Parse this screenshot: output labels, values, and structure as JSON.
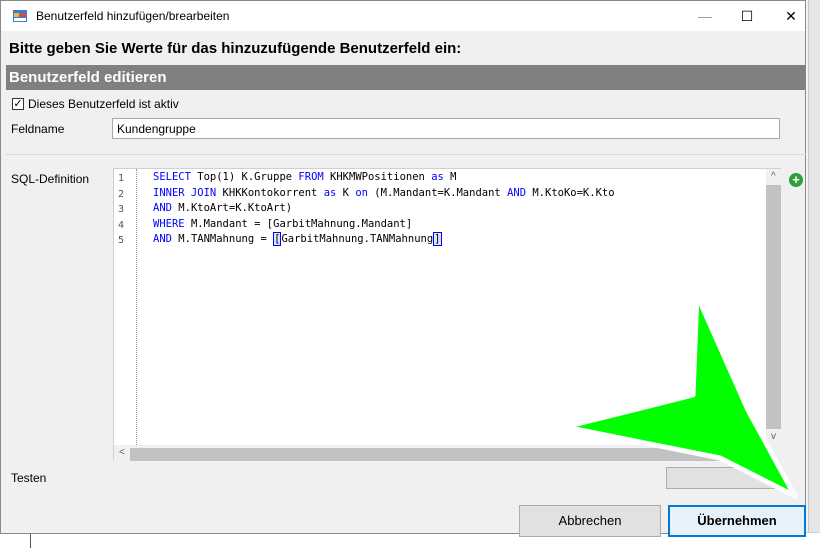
{
  "window": {
    "title": "Benutzerfeld hinzufügen/brearbeiten",
    "minimize_glyph": "—",
    "maximize_glyph": "☐",
    "close_glyph": "✕",
    "icon": "app-window-icon"
  },
  "instruction": "Bitte geben Sie Werte für das hinzuzufügende Benutzerfeld ein:",
  "section_header": "Benutzerfeld editieren",
  "active_checkbox": {
    "label": "Dieses Benutzerfeld ist aktiv",
    "checked": true,
    "glyph": "✓"
  },
  "feldname": {
    "label": "Feldname",
    "value": "Kundengruppe"
  },
  "sql": {
    "label": "SQL-Definition",
    "line_numbers": [
      "1",
      "2",
      "3",
      "4",
      "5"
    ],
    "lines": [
      [
        {
          "t": "SELECT ",
          "k": true
        },
        {
          "t": "Top"
        },
        {
          "t": "(1) K.Gruppe "
        },
        {
          "t": "FROM ",
          "k": true
        },
        {
          "t": "KHKMWPositionen "
        },
        {
          "t": "as ",
          "k": true
        },
        {
          "t": "M"
        }
      ],
      [
        {
          "t": "INNER JOIN ",
          "k": true
        },
        {
          "t": "KHKKontokorrent "
        },
        {
          "t": "as ",
          "k": true
        },
        {
          "t": "K "
        },
        {
          "t": "on ",
          "k": true
        },
        {
          "t": "(M.Mandant=K.Mandant "
        },
        {
          "t": "AND ",
          "k": true
        },
        {
          "t": "M.KtoKo=K.Kto"
        }
      ],
      [
        {
          "t": "AND ",
          "k": true
        },
        {
          "t": "M.KtoArt=K.KtoArt)"
        }
      ],
      [
        {
          "t": "WHERE ",
          "k": true
        },
        {
          "t": "M.Mandant = [GarbitMahnung.Mandant]"
        }
      ],
      [
        {
          "t": "AND ",
          "k": true
        },
        {
          "t": "M.TANMahnung = "
        },
        {
          "t": "[",
          "h": true
        },
        {
          "t": "GarbitMahnung.TANMahnung"
        },
        {
          "t": "]",
          "h": true
        }
      ]
    ],
    "scroll_up_glyph": "^",
    "scroll_down_glyph": "v",
    "scroll_left_glyph": "<"
  },
  "add_icon": {
    "name": "add-icon",
    "glyph": "+",
    "color": "#2e9e3e"
  },
  "testen": {
    "label": "Testen"
  },
  "buttons": {
    "cancel": "Abbrechen",
    "apply": "Übernehmen"
  },
  "colors": {
    "header_bg": "#808080",
    "keyword": "#0000ff",
    "accent": "#0078d7",
    "annotation_arrow": "#00ff00"
  }
}
